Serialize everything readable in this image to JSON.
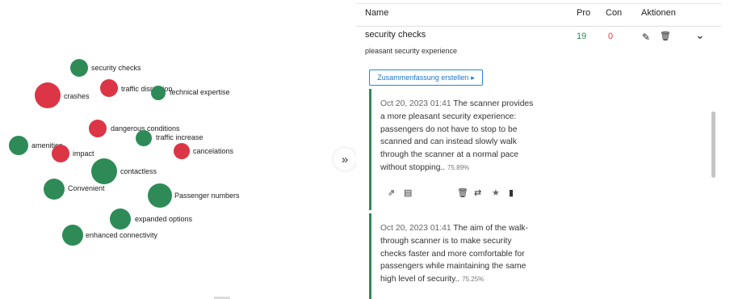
{
  "bubbles": [
    {
      "label": "security checks",
      "color": "#2e8b57",
      "kind": "pro"
    },
    {
      "label": "crashes",
      "color": "#dc3545",
      "kind": "con"
    },
    {
      "label": "traffic disruption",
      "color": "#dc3545",
      "kind": "con"
    },
    {
      "label": "technical expertise",
      "color": "#2e8b57",
      "kind": "pro"
    },
    {
      "label": "dangerous conditions",
      "color": "#dc3545",
      "kind": "con"
    },
    {
      "label": "traffic increase",
      "color": "#2e8b57",
      "kind": "pro"
    },
    {
      "label": "amenities",
      "color": "#2e8b57",
      "kind": "pro"
    },
    {
      "label": "impact",
      "color": "#dc3545",
      "kind": "con"
    },
    {
      "label": "cancelations",
      "color": "#dc3545",
      "kind": "con"
    },
    {
      "label": "contactless",
      "color": "#2e8b57",
      "kind": "pro"
    },
    {
      "label": "Convenient",
      "color": "#2e8b57",
      "kind": "pro"
    },
    {
      "label": "Passenger numbers",
      "color": "#2e8b57",
      "kind": "pro"
    },
    {
      "label": "expanded options",
      "color": "#2e8b57",
      "kind": "pro"
    },
    {
      "label": "enhanced connectivity",
      "color": "#2e8b57",
      "kind": "pro"
    }
  ],
  "toggle": {
    "icon": "»"
  },
  "table": {
    "headers": {
      "name": "Name",
      "pro": "Pro",
      "con": "Con",
      "actions": "Aktionen"
    },
    "row": {
      "name": "security checks",
      "description": "pleasant security experience",
      "pro": "19",
      "con": "0"
    }
  },
  "icons": {
    "edit": "✎",
    "delete": "🗑",
    "expand": "⌄",
    "open": "⇗",
    "doc": "▤",
    "swap": "⇄",
    "star": "★",
    "clipboard": "▮",
    "caret": "▸"
  },
  "summary_button": {
    "label": "Zusammenfassung erstellen"
  },
  "evidence": [
    {
      "date": "Oct 20, 2023 01:41",
      "text": "The scanner provides a more pleasant security experience: passengers do not have to stop to be scanned and can instead slowly walk through the scanner at a normal pace without stopping..",
      "score": "75.89%"
    },
    {
      "date": "Oct 20, 2023 01:41",
      "text": "The aim of the walk-through scanner is to make security checks faster and more comfortable for passengers while maintaining the same high level of security..",
      "score": "75.25%"
    }
  ],
  "colors": {
    "pro": "#2e8b57",
    "con": "#dc3545",
    "accent": "#1e88e5"
  }
}
